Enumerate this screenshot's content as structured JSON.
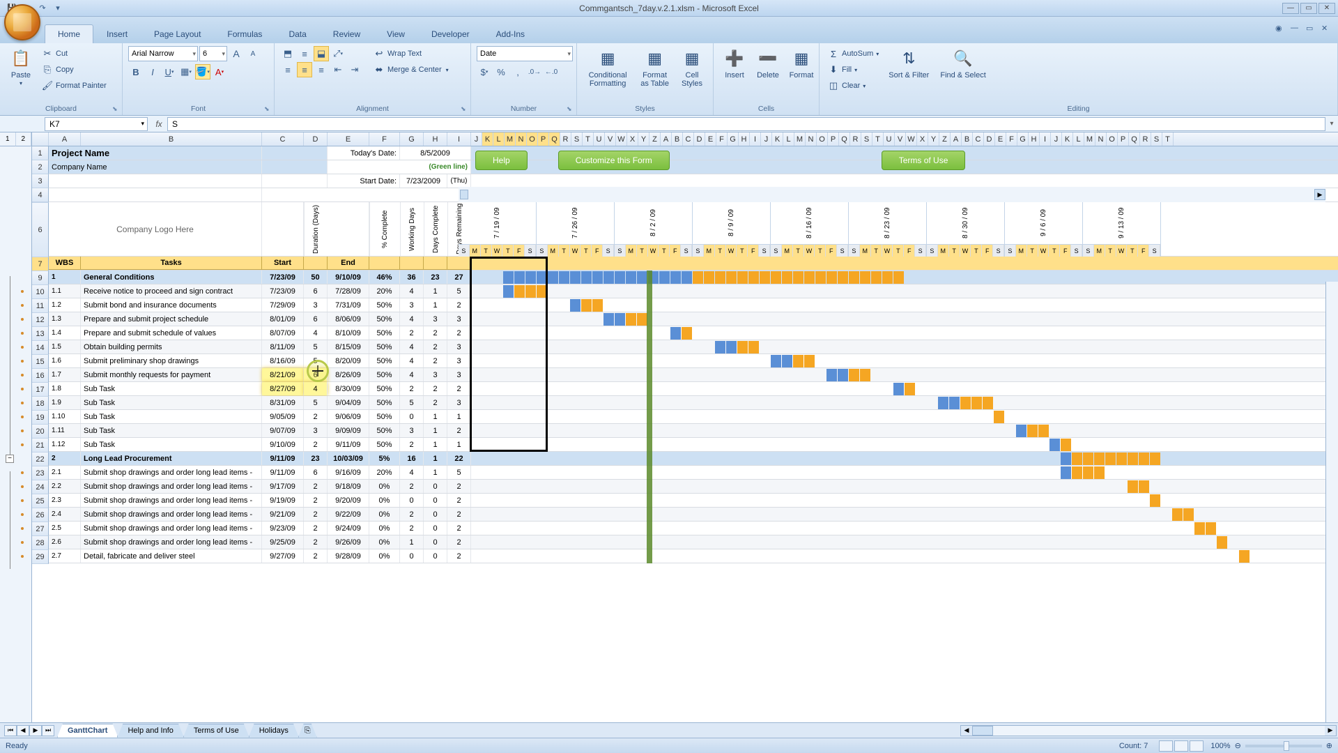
{
  "app": {
    "title": "Commgantsch_7day.v.2.1.xlsm - Microsoft Excel"
  },
  "tabs": [
    "Home",
    "Insert",
    "Page Layout",
    "Formulas",
    "Data",
    "Review",
    "View",
    "Developer",
    "Add-Ins"
  ],
  "active_tab": "Home",
  "ribbon": {
    "clipboard": {
      "label": "Clipboard",
      "paste": "Paste",
      "cut": "Cut",
      "copy": "Copy",
      "format_painter": "Format Painter"
    },
    "font": {
      "label": "Font",
      "family": "Arial Narrow",
      "size": "6"
    },
    "alignment": {
      "label": "Alignment",
      "wrap": "Wrap Text",
      "merge": "Merge & Center"
    },
    "number": {
      "label": "Number",
      "format": "Date"
    },
    "styles": {
      "label": "Styles",
      "cond": "Conditional Formatting",
      "fat": "Format as Table",
      "cs": "Cell Styles"
    },
    "cells": {
      "label": "Cells",
      "insert": "Insert",
      "delete": "Delete",
      "format": "Format"
    },
    "editing": {
      "label": "Editing",
      "autosum": "AutoSum",
      "fill": "Fill",
      "clear": "Clear",
      "sort": "Sort & Filter",
      "find": "Find & Select"
    }
  },
  "namebox": "K7",
  "formula": "S",
  "header_rows": {
    "r1": "Project Name",
    "r2": "Company Name",
    "logo": "Company Logo Here",
    "today_lbl": "Today's Date:",
    "today_val": "8/5/2009",
    "green_line": "(Green line)",
    "start_lbl": "Start Date:",
    "start_val": "7/23/2009",
    "start_day": "(Thu)"
  },
  "buttons": {
    "help": "Help",
    "customize": "Customize this Form",
    "terms": "Terms of Use"
  },
  "col_labels": {
    "wbs": "WBS",
    "tasks": "Tasks",
    "start": "Start",
    "dur": "Duration (Days)",
    "end": "End",
    "pct": "% Complete",
    "wd": "Working Days",
    "dc": "Days Complete",
    "dr": "Days Remaining"
  },
  "weeks": [
    "7 / 19 / 09",
    "7 / 26 / 09",
    "8 / 2 / 09",
    "8 / 9 / 09",
    "8 / 16 / 09",
    "8 / 23 / 09",
    "8 / 30 / 09",
    "9 / 6 / 09",
    "9 / 13 / 09"
  ],
  "day_letters": [
    "S",
    "M",
    "T",
    "W",
    "T",
    "F",
    "S"
  ],
  "rows": [
    {
      "n": 9,
      "wbs": "1",
      "task": "General Conditions",
      "start": "7/23/09",
      "dur": "50",
      "end": "9/10/09",
      "pct": "46%",
      "wd": "36",
      "dc": "23",
      "dr": "27",
      "group": true,
      "gstart": 4,
      "glen": 36,
      "comp": 17
    },
    {
      "n": 10,
      "wbs": "1.1",
      "task": "Receive notice to proceed and sign contract",
      "start": "7/23/09",
      "dur": "6",
      "end": "7/28/09",
      "pct": "20%",
      "wd": "4",
      "dc": "1",
      "dr": "5",
      "gstart": 4,
      "glen": 4,
      "comp": 1
    },
    {
      "n": 11,
      "wbs": "1.2",
      "task": "Submit bond and insurance documents",
      "start": "7/29/09",
      "dur": "3",
      "end": "7/31/09",
      "pct": "50%",
      "wd": "3",
      "dc": "1",
      "dr": "2",
      "gstart": 10,
      "glen": 3,
      "comp": 1
    },
    {
      "n": 12,
      "wbs": "1.3",
      "task": "Prepare and submit project schedule",
      "start": "8/01/09",
      "dur": "6",
      "end": "8/06/09",
      "pct": "50%",
      "wd": "4",
      "dc": "3",
      "dr": "3",
      "gstart": 13,
      "glen": 4,
      "comp": 2
    },
    {
      "n": 13,
      "wbs": "1.4",
      "task": "Prepare and submit schedule of values",
      "start": "8/07/09",
      "dur": "4",
      "end": "8/10/09",
      "pct": "50%",
      "wd": "2",
      "dc": "2",
      "dr": "2",
      "gstart": 19,
      "glen": 2,
      "comp": 1
    },
    {
      "n": 14,
      "wbs": "1.5",
      "task": "Obtain building permits",
      "start": "8/11/09",
      "dur": "5",
      "end": "8/15/09",
      "pct": "50%",
      "wd": "4",
      "dc": "2",
      "dr": "3",
      "gstart": 23,
      "glen": 4,
      "comp": 2
    },
    {
      "n": 15,
      "wbs": "1.6",
      "task": "Submit preliminary shop drawings",
      "start": "8/16/09",
      "dur": "5",
      "end": "8/20/09",
      "pct": "50%",
      "wd": "4",
      "dc": "2",
      "dr": "3",
      "gstart": 28,
      "glen": 4,
      "comp": 2
    },
    {
      "n": 16,
      "wbs": "1.7",
      "task": "Submit monthly requests for payment",
      "start": "8/21/09",
      "dur": "6",
      "end": "8/26/09",
      "pct": "50%",
      "wd": "4",
      "dc": "3",
      "dr": "3",
      "gstart": 33,
      "glen": 4,
      "comp": 2,
      "hl": true
    },
    {
      "n": 17,
      "wbs": "1.8",
      "task": "Sub Task",
      "start": "8/27/09",
      "dur": "4",
      "end": "8/30/09",
      "pct": "50%",
      "wd": "2",
      "dc": "2",
      "dr": "2",
      "gstart": 39,
      "glen": 2,
      "comp": 1,
      "hl": true
    },
    {
      "n": 18,
      "wbs": "1.9",
      "task": "Sub Task",
      "start": "8/31/09",
      "dur": "5",
      "end": "9/04/09",
      "pct": "50%",
      "wd": "5",
      "dc": "2",
      "dr": "3",
      "gstart": 43,
      "glen": 5,
      "comp": 2
    },
    {
      "n": 19,
      "wbs": "1.10",
      "task": "Sub Task",
      "start": "9/05/09",
      "dur": "2",
      "end": "9/06/09",
      "pct": "50%",
      "wd": "0",
      "dc": "1",
      "dr": "1",
      "gstart": 48,
      "glen": 1,
      "comp": 0
    },
    {
      "n": 20,
      "wbs": "1.11",
      "task": "Sub Task",
      "start": "9/07/09",
      "dur": "3",
      "end": "9/09/09",
      "pct": "50%",
      "wd": "3",
      "dc": "1",
      "dr": "2",
      "gstart": 50,
      "glen": 3,
      "comp": 1
    },
    {
      "n": 21,
      "wbs": "1.12",
      "task": "Sub Task",
      "start": "9/10/09",
      "dur": "2",
      "end": "9/11/09",
      "pct": "50%",
      "wd": "2",
      "dc": "1",
      "dr": "1",
      "gstart": 53,
      "glen": 2,
      "comp": 1
    },
    {
      "n": 22,
      "wbs": "2",
      "task": "Long Lead Procurement",
      "start": "9/11/09",
      "dur": "23",
      "end": "10/03/09",
      "pct": "5%",
      "wd": "16",
      "dc": "1",
      "dr": "22",
      "group": true,
      "gstart": 54,
      "glen": 9,
      "comp": 1
    },
    {
      "n": 23,
      "wbs": "2.1",
      "task": "Submit shop drawings and order long lead items -",
      "start": "9/11/09",
      "dur": "6",
      "end": "9/16/09",
      "pct": "20%",
      "wd": "4",
      "dc": "1",
      "dr": "5",
      "gstart": 54,
      "glen": 4,
      "comp": 1
    },
    {
      "n": 24,
      "wbs": "2.2",
      "task": "Submit shop drawings and order long lead items -",
      "start": "9/17/09",
      "dur": "2",
      "end": "9/18/09",
      "pct": "0%",
      "wd": "2",
      "dc": "0",
      "dr": "2",
      "gstart": 60,
      "glen": 2,
      "comp": 0
    },
    {
      "n": 25,
      "wbs": "2.3",
      "task": "Submit shop drawings and order long lead items -",
      "start": "9/19/09",
      "dur": "2",
      "end": "9/20/09",
      "pct": "0%",
      "wd": "0",
      "dc": "0",
      "dr": "2",
      "gstart": 62,
      "glen": 1,
      "comp": 0
    },
    {
      "n": 26,
      "wbs": "2.4",
      "task": "Submit shop drawings and order long lead items -",
      "start": "9/21/09",
      "dur": "2",
      "end": "9/22/09",
      "pct": "0%",
      "wd": "2",
      "dc": "0",
      "dr": "2",
      "gstart": 64,
      "glen": 2,
      "comp": 0
    },
    {
      "n": 27,
      "wbs": "2.5",
      "task": "Submit shop drawings and order long lead items -",
      "start": "9/23/09",
      "dur": "2",
      "end": "9/24/09",
      "pct": "0%",
      "wd": "2",
      "dc": "0",
      "dr": "2",
      "gstart": 66,
      "glen": 2,
      "comp": 0
    },
    {
      "n": 28,
      "wbs": "2.6",
      "task": "Submit shop drawings and order long lead items -",
      "start": "9/25/09",
      "dur": "2",
      "end": "9/26/09",
      "pct": "0%",
      "wd": "1",
      "dc": "0",
      "dr": "2",
      "gstart": 68,
      "glen": 1,
      "comp": 0
    },
    {
      "n": 29,
      "wbs": "2.7",
      "task": "Detail, fabricate and deliver steel",
      "start": "9/27/09",
      "dur": "2",
      "end": "9/28/09",
      "pct": "0%",
      "wd": "0",
      "dc": "0",
      "dr": "2",
      "gstart": 70,
      "glen": 1,
      "comp": 0
    }
  ],
  "col_widths": {
    "A": 46,
    "B": 260,
    "C": 60,
    "D": 34,
    "E": 60,
    "F": 44,
    "G": 34,
    "H": 34,
    "I": 34
  },
  "sheet_tabs": [
    "GanttChart",
    "Help and Info",
    "Terms of Use",
    "Holidays"
  ],
  "active_sheet": "GanttChart",
  "status": {
    "ready": "Ready",
    "count_lbl": "Count:",
    "count_val": "7",
    "zoom": "100%"
  }
}
